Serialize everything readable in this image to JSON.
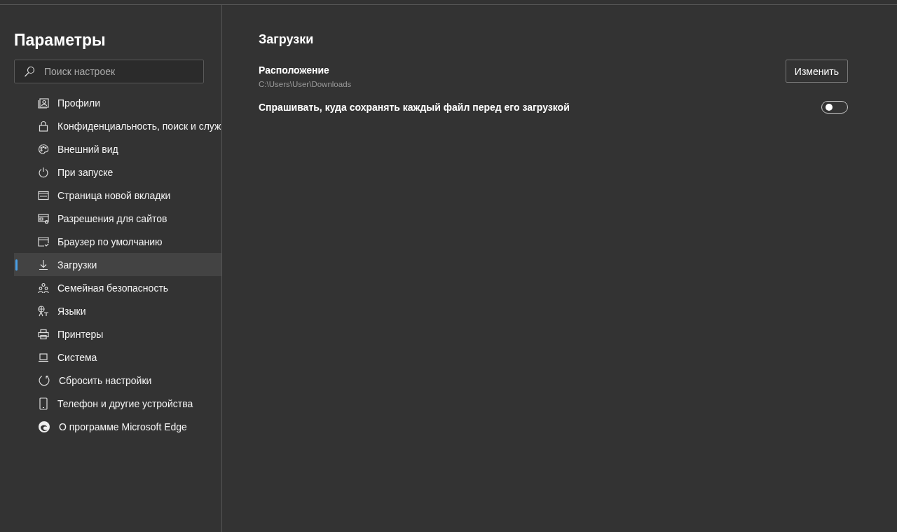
{
  "sidebar": {
    "title": "Параметры",
    "search": {
      "placeholder": "Поиск настроек"
    },
    "items": [
      {
        "label": "Профили",
        "selected": false
      },
      {
        "label": "Конфиденциальность, поиск и служ",
        "selected": false
      },
      {
        "label": "Внешний вид",
        "selected": false
      },
      {
        "label": "При запуске",
        "selected": false
      },
      {
        "label": "Страница новой вкладки",
        "selected": false
      },
      {
        "label": "Разрешения для сайтов",
        "selected": false
      },
      {
        "label": "Браузер по умолчанию",
        "selected": false
      },
      {
        "label": "Загрузки",
        "selected": true
      },
      {
        "label": "Семейная безопасность",
        "selected": false
      },
      {
        "label": "Языки",
        "selected": false
      },
      {
        "label": "Принтеры",
        "selected": false
      },
      {
        "label": "Система",
        "selected": false
      },
      {
        "label": "Сбросить настройки",
        "selected": false
      },
      {
        "label": "Телефон и другие устройства",
        "selected": false
      },
      {
        "label": "О программе Microsoft Edge",
        "selected": false
      }
    ]
  },
  "main": {
    "title": "Загрузки",
    "location": {
      "label": "Расположение",
      "path": "C:\\Users\\User\\Downloads",
      "button": "Изменить"
    },
    "ask_toggle": {
      "label": "Спрашивать, куда сохранять каждый файл перед его загрузкой",
      "on": false
    }
  }
}
